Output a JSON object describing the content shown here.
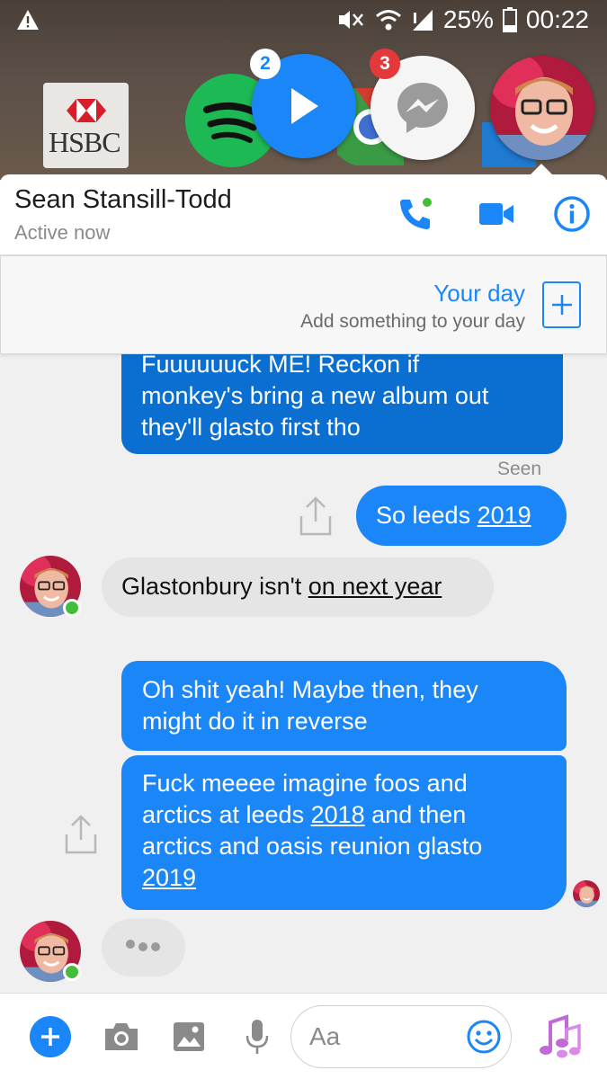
{
  "status_bar": {
    "battery": "25%",
    "time": "00:22",
    "icons": [
      "warning-icon",
      "mute-icon",
      "wifi-icon",
      "signal-icon",
      "battery-icon"
    ]
  },
  "home_apps": {
    "hsbc_label": "HSBC"
  },
  "chat_heads": {
    "play_badge": "2",
    "messenger_badge": "3"
  },
  "header": {
    "name": "Sean Stansill-Todd",
    "status": "Active now",
    "icons": [
      "phone-icon",
      "video-icon",
      "info-icon"
    ]
  },
  "your_day": {
    "title": "Your day",
    "subtitle": "Add something to your day"
  },
  "messages": [
    {
      "from": "me",
      "lines": [
        "Fuuuuuuck ME! Reckon if",
        "monkey's bring a new album out",
        "they'll glasto first tho"
      ]
    },
    {
      "from": "meta",
      "text": "Seen"
    },
    {
      "from": "me",
      "prefix": "So leeds ",
      "link": "2019"
    },
    {
      "from": "them",
      "prefix": "Glastonbury isn't ",
      "link": "on next year"
    },
    {
      "from": "me",
      "lines": [
        "Oh shit yeah! Maybe then, they",
        "might do it in reverse"
      ]
    },
    {
      "from": "me",
      "l1": "Fuck meeee imagine foos and",
      "l2a": "arctics at leeds ",
      "l2link": "2018",
      "l2b": " and then",
      "l3": "arctics and oasis reunion glasto",
      "l4link": "2019"
    }
  ],
  "composer": {
    "placeholder": "Aa",
    "icons": [
      "plus-icon",
      "camera-icon",
      "image-icon",
      "microphone-icon",
      "emoji-icon",
      "music-icon"
    ]
  },
  "colors": {
    "messenger_blue": "#1b86f7",
    "outgoing_dark": "#0a6fd0",
    "incoming": "#e5e5e5",
    "online": "#44be3a",
    "badge_red": "#e5383b"
  }
}
